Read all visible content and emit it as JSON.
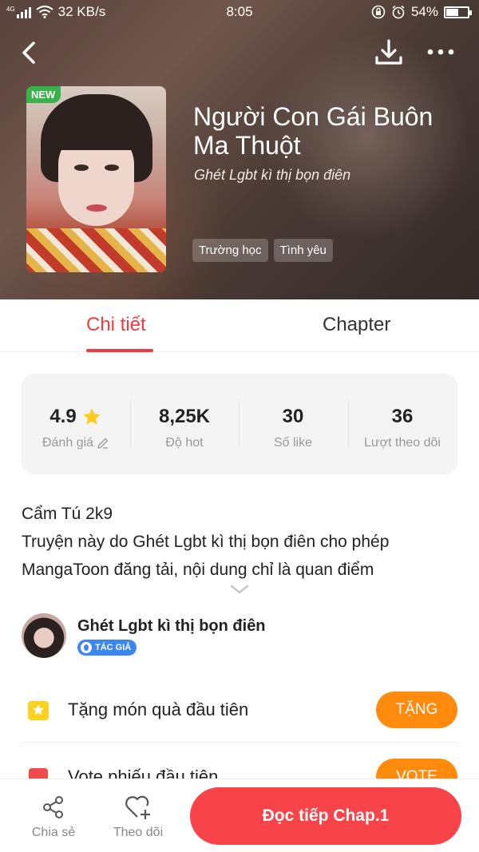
{
  "status_bar": {
    "network": "4G",
    "speed": "32 KB/s",
    "time": "8:05",
    "battery_percent": "54%",
    "battery_level": 0.54
  },
  "header": {
    "cover_badge": "NEW",
    "title": "Người Con Gái Buôn Ma Thuột",
    "author_subtitle": "Ghét Lgbt kì thị bọn điên",
    "tags": [
      "Trường học",
      "Tình yêu"
    ]
  },
  "tabs": [
    {
      "label": "Chi tiết",
      "active": true
    },
    {
      "label": "Chapter",
      "active": false
    }
  ],
  "stats": [
    {
      "value": "4.9",
      "label": "Đánh giá"
    },
    {
      "value": "8,25K",
      "label": "Độ hot"
    },
    {
      "value": "30",
      "label": "Số like"
    },
    {
      "value": "36",
      "label": "Lượt theo dõi"
    }
  ],
  "description": {
    "line1": "Cẩm Tú 2k9",
    "line2": "Truyện này do Ghét Lgbt kì thị bọn điên cho phép MangaToon đăng tải, nội dung chỉ là quan điểm"
  },
  "author": {
    "name": "Ghét Lgbt kì thị bọn điên",
    "badge": "TÁC GIẢ"
  },
  "actions": {
    "gift_text": "Tặng món quà đầu tiên",
    "gift_button": "TẶNG",
    "vote_text": "Vote phiếu đầu tiên",
    "vote_button": "VOTE"
  },
  "bottom_bar": {
    "share_label": "Chia sẻ",
    "follow_label": "Theo dõi",
    "read_button": "Đọc tiếp Chap.1"
  },
  "colors": {
    "accent_red": "#ef3a3f",
    "orange_button": "#ff8a0c",
    "read_button": "#f84349",
    "new_badge": "#37b34a",
    "author_badge": "#3c86f2"
  }
}
